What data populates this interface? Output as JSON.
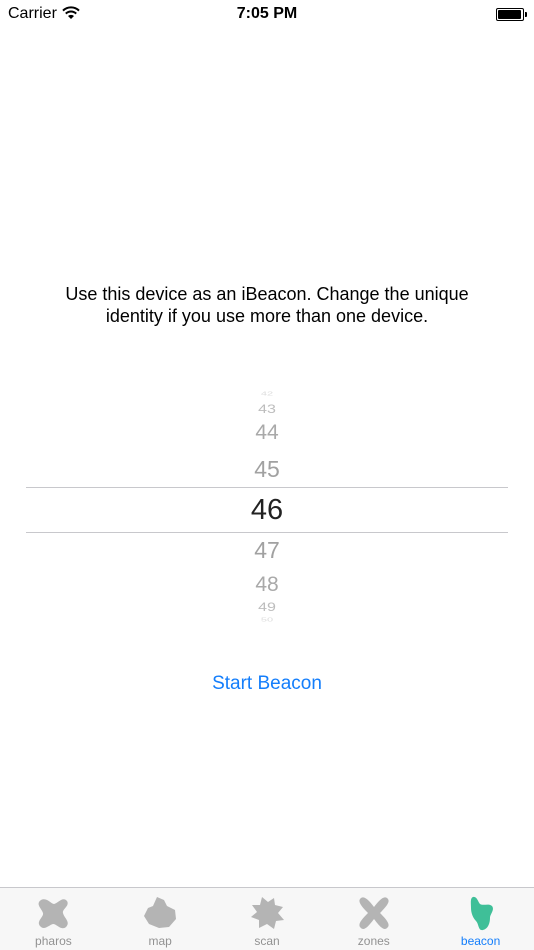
{
  "status_bar": {
    "carrier": "Carrier",
    "time": "7:05 PM"
  },
  "description": "Use this device as an iBeacon. Change the unique identity if you use more than one device.",
  "picker": {
    "selected": "46",
    "values_above": [
      "42",
      "43",
      "44",
      "45"
    ],
    "values_below": [
      "47",
      "48",
      "49",
      "50"
    ]
  },
  "start_button": "Start Beacon",
  "tabs": [
    {
      "label": "pharos",
      "icon": "pharos-icon",
      "active": false
    },
    {
      "label": "map",
      "icon": "map-icon",
      "active": false
    },
    {
      "label": "scan",
      "icon": "scan-icon",
      "active": false
    },
    {
      "label": "zones",
      "icon": "zones-icon",
      "active": false
    },
    {
      "label": "beacon",
      "icon": "beacon-icon",
      "active": true
    }
  ],
  "colors": {
    "accent": "#147efb",
    "active_icon": "#3fbf98",
    "inactive_icon": "#b4b4b4"
  }
}
